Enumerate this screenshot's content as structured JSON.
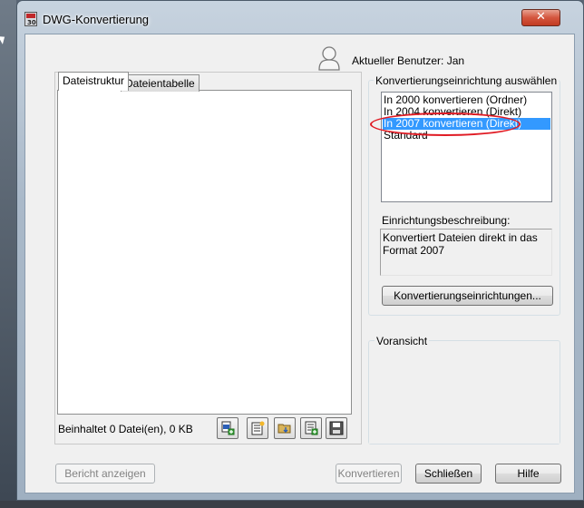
{
  "window": {
    "title": "DWG-Konvertierung",
    "icon_text": "30",
    "close_glyph": "✕"
  },
  "user": {
    "label": "Aktueller Benutzer: Jan",
    "icon": "user-silhouette-icon"
  },
  "tabs": [
    {
      "label": "Dateistruktur",
      "active": true
    },
    {
      "label": "Dateientabelle",
      "active": false
    }
  ],
  "file_info": "Beinhaltet 0 Datei(en), 0 KB",
  "toolbar_icons": [
    "add-file-icon",
    "new-list-icon",
    "open-folder-icon",
    "add-list-icon",
    "save-icon"
  ],
  "conversion": {
    "group_title": "Konvertierungseinrichtung auswählen",
    "items": [
      "In 2000 konvertieren (Ordner)",
      "In 2004 konvertieren (Direkt)",
      "In 2007 konvertieren (Direkt)",
      "Standard"
    ],
    "selected_index": 2,
    "description_label": "Einrichtungsbeschreibung:",
    "description": "Konvertiert Dateien direkt in das Format 2007",
    "settings_button": "Konvertierungseinrichtungen..."
  },
  "preview": {
    "title": "Voransicht"
  },
  "buttons": {
    "report": "Bericht anzeigen",
    "convert": "Konvertieren",
    "close": "Schließen",
    "help": "Hilfe"
  },
  "colors": {
    "selection": "#3399ff",
    "annotation": "#e01b24",
    "close_button": "#c13b22"
  }
}
